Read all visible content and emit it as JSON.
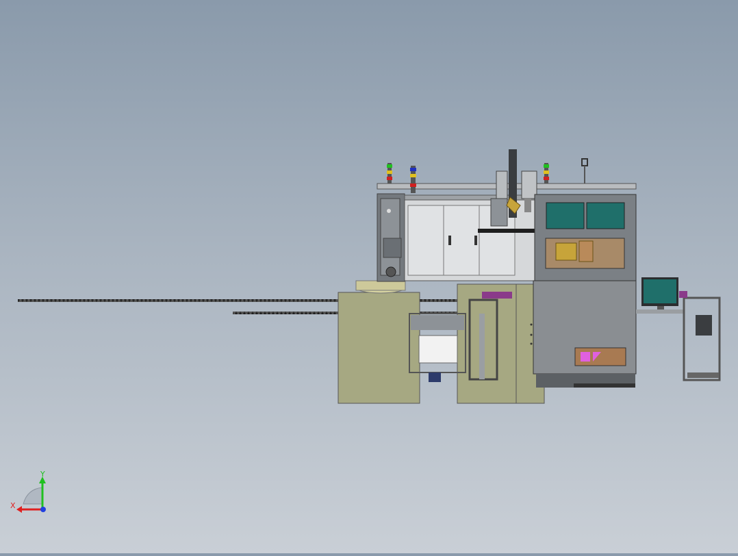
{
  "viewport": {
    "background_top": "#8a9aab",
    "background_bottom": "#c9cfd6"
  },
  "triad": {
    "x_label": "X",
    "y_label": "Y",
    "x_color": "#e02020",
    "y_color": "#20c020",
    "z_color": "#2040e0"
  },
  "colors": {
    "frame_gray": "#6e7378",
    "panel_light": "#d5d7d9",
    "cabinet": "#a3a58a",
    "teal_window": "#1f6f6a",
    "chain": "#2a2a2a",
    "accent_purple": "#8a3a8a",
    "accent_pink": "#e060e0"
  }
}
